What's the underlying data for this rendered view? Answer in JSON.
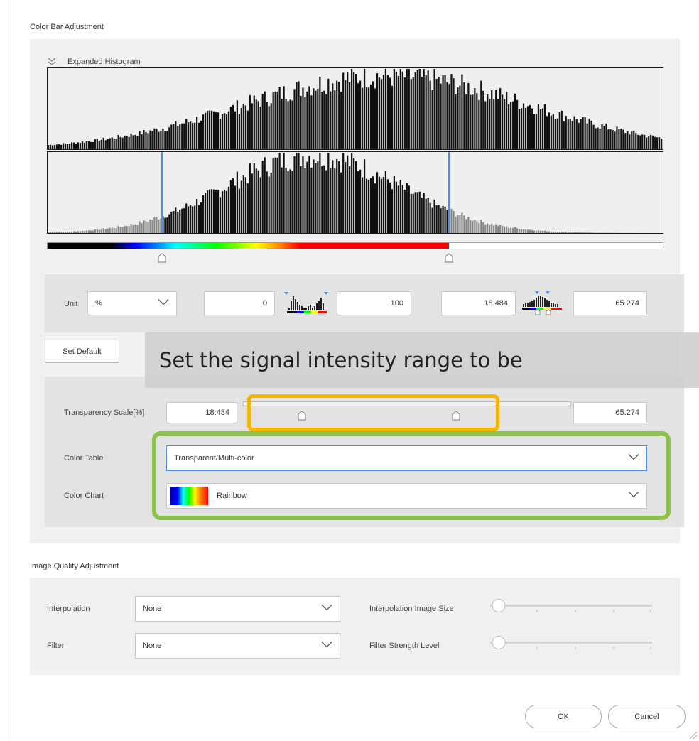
{
  "colors": {
    "accent_blue": "#4a8ef0",
    "highlight_orange": "#f7b500",
    "highlight_green": "#8bc34a",
    "panel_bg": "#f0f0f0",
    "subpanel_bg": "#e3e3e3"
  },
  "color_bar": {
    "title": "Color Bar Adjustment",
    "histogram_label": "Expanded Histogram",
    "histogram_toggle_icon": "double-chevron-down-icon",
    "lower_marker_fraction": 0.186,
    "upper_marker_fraction": 0.651,
    "colorbar_fill_fraction": 0.651
  },
  "unit_row": {
    "unit_label": "Unit",
    "unit_value": "%",
    "range_min": "0",
    "range_max": "100",
    "window_min": "18.484",
    "window_max": "65.274"
  },
  "set_default_label": "Set Default",
  "overlay_caption": "Set the signal intensity range to be",
  "transparency": {
    "label": "Transparency Scale[%]",
    "min_value": "18.484",
    "max_value": "65.274",
    "lower_thumb_fraction": 0.18,
    "upper_thumb_fraction": 0.65
  },
  "color_table": {
    "label": "Color Table",
    "value": "Transparent/Multi-color"
  },
  "color_chart": {
    "label": "Color Chart",
    "value": "Rainbow"
  },
  "image_quality": {
    "title": "Image Quality Adjustment",
    "interpolation_label": "Interpolation",
    "interpolation_value": "None",
    "filter_label": "Filter",
    "filter_value": "None",
    "interp_size_label": "Interpolation Image Size",
    "filter_strength_label": "Filter Strength Level",
    "interp_size_level": 0,
    "filter_strength_level": 0
  },
  "footer": {
    "ok_label": "OK",
    "cancel_label": "Cancel"
  }
}
